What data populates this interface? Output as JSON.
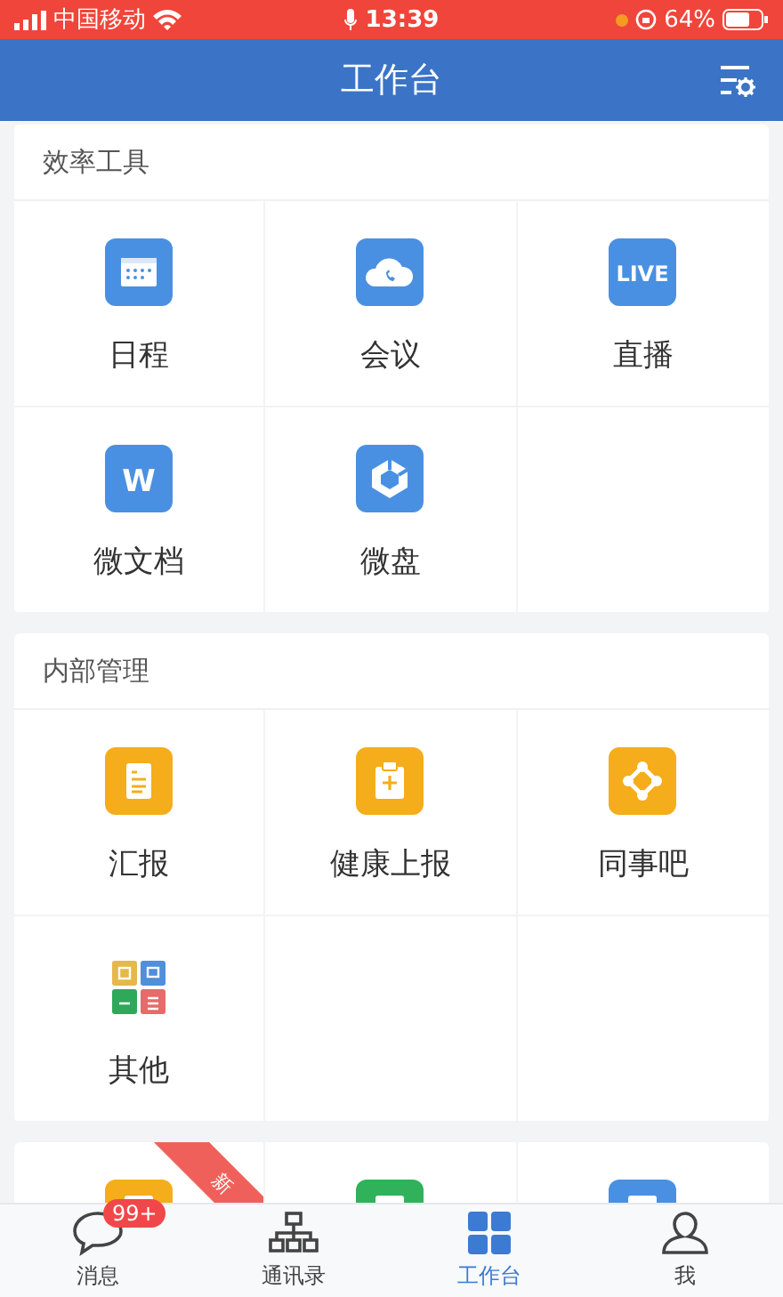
{
  "status_bar": {
    "carrier": "中国移动",
    "time": "13:39",
    "battery": "64%"
  },
  "nav_bar": {
    "title": "工作台"
  },
  "sections": [
    {
      "title": "效率工具",
      "items": [
        {
          "kind": "calendar",
          "label": "日程"
        },
        {
          "kind": "meeting",
          "label": "会议"
        },
        {
          "kind": "live",
          "label": "直播",
          "icon_text": "LIVE"
        },
        {
          "kind": "doc",
          "label": "微文档",
          "icon_text": "W"
        },
        {
          "kind": "disk",
          "label": "微盘"
        }
      ]
    },
    {
      "title": "内部管理",
      "items": [
        {
          "kind": "report",
          "label": "汇报"
        },
        {
          "kind": "health",
          "label": "健康上报"
        },
        {
          "kind": "colleague",
          "label": "同事吧"
        },
        {
          "kind": "more",
          "label": "其他"
        }
      ]
    },
    {
      "items": [
        {
          "kind": "partial-yellow",
          "ribbon": "新"
        },
        {
          "kind": "partial-green"
        },
        {
          "kind": "partial-blue"
        }
      ]
    }
  ],
  "tab_bar": [
    {
      "kind": "chat",
      "label": "消息",
      "badge": "99+",
      "selected": false
    },
    {
      "kind": "contacts",
      "label": "通讯录",
      "selected": false
    },
    {
      "kind": "workbench",
      "label": "工作台",
      "selected": true
    },
    {
      "kind": "me",
      "label": "我",
      "selected": false
    }
  ]
}
